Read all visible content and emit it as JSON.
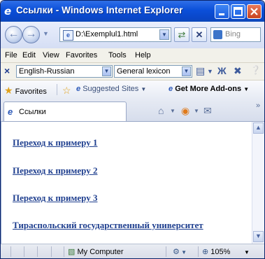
{
  "window": {
    "title": "Ссылки - Windows Internet Explorer",
    "ie_icon": "ie-logo-icon"
  },
  "nav": {
    "address": "D:\\Exemplul1.html",
    "search_placeholder": "Bing"
  },
  "menu": {
    "items": [
      {
        "label": "File",
        "key": "F"
      },
      {
        "label": "Edit",
        "key": "E"
      },
      {
        "label": "View",
        "key": "V"
      },
      {
        "label": "Favorites",
        "key": "a"
      },
      {
        "label": "Tools",
        "key": "T"
      },
      {
        "label": "Help",
        "key": "H"
      }
    ]
  },
  "translation_bar": {
    "language": "English-Russian",
    "lexicon": "General lexicon"
  },
  "favorites_bar": {
    "favorites": "Favorites",
    "suggested": "Suggested Sites",
    "addons": "Get More Add-ons"
  },
  "tab": {
    "label": "Ссылки"
  },
  "content": {
    "links": [
      "Переход к примеру 1",
      "Переход к примеру 2",
      "Переход к примеру 3",
      "Тираспольский государственный университет"
    ]
  },
  "status": {
    "zone": "My Computer",
    "zoom": "105%"
  }
}
